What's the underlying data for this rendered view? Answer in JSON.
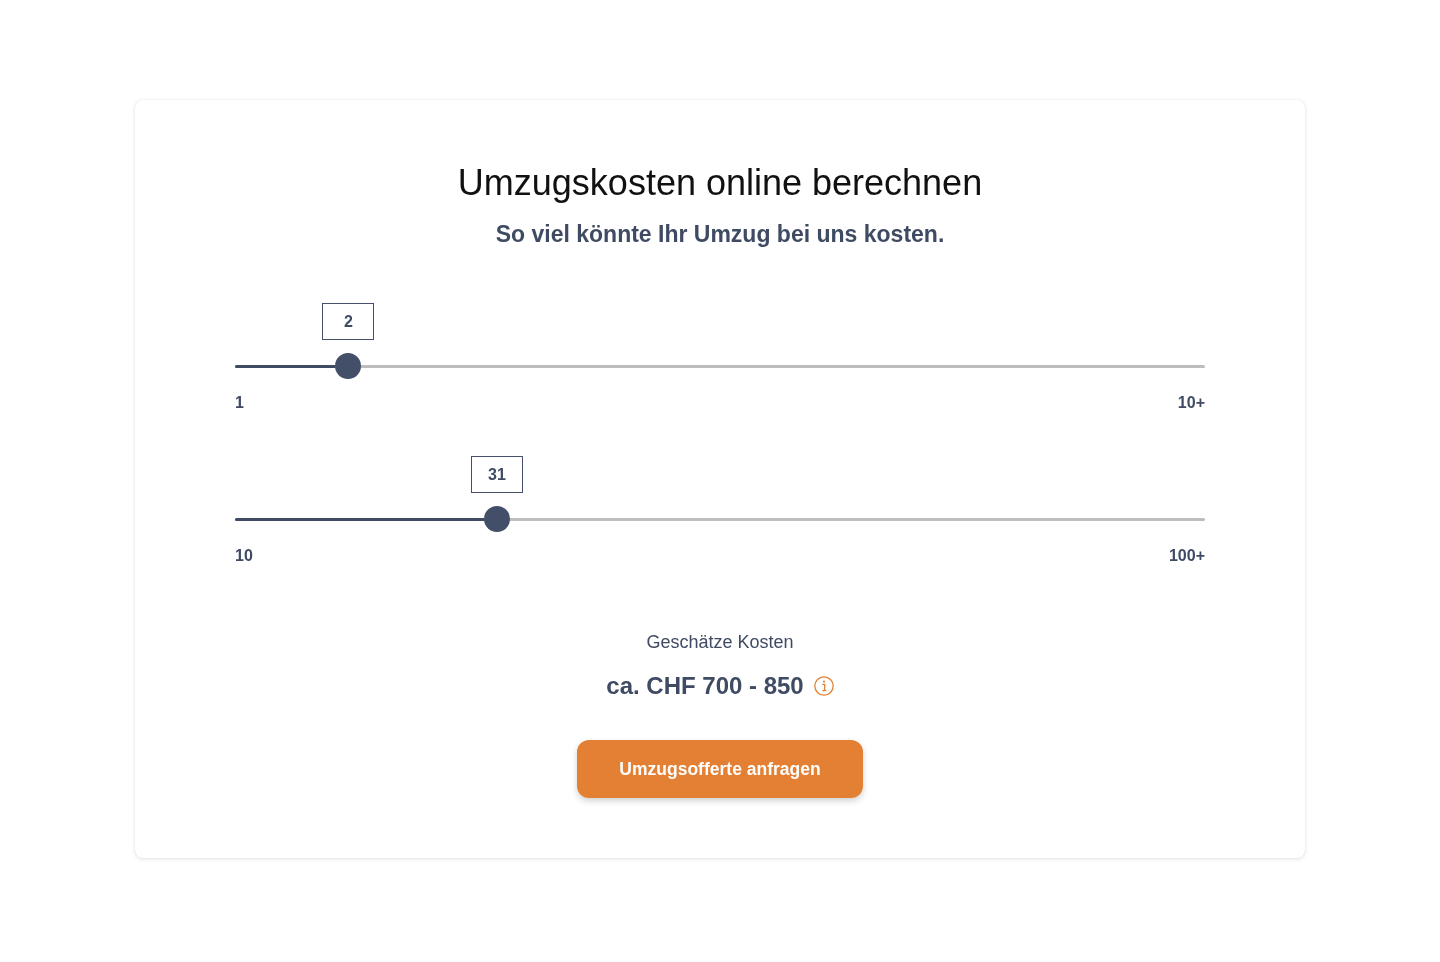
{
  "calculator": {
    "title": "Umzugskosten online berechnen",
    "subtitle": "So viel könnte Ihr Umzug bei uns kosten.",
    "sliders": [
      {
        "value": "2",
        "level": 0.117,
        "min_label": "1",
        "max_label": "10+"
      },
      {
        "value": "31",
        "level": 0.27,
        "min_label": "10",
        "max_label": "100+"
      }
    ],
    "estimate": {
      "label": "Geschätze Kosten",
      "amount": "ca. CHF 700 - 850"
    },
    "button": "Umzugsofferte anfragen"
  }
}
